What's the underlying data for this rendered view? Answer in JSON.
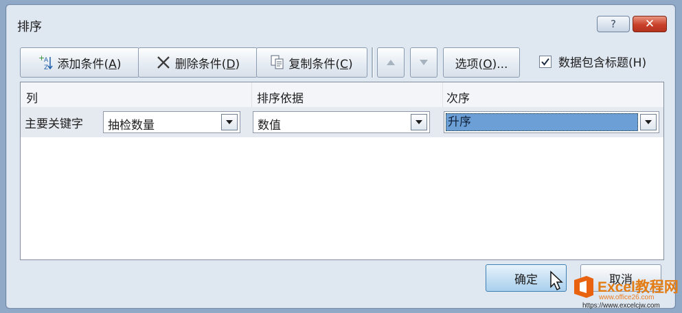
{
  "window": {
    "title": "排序",
    "help_label": "?",
    "close_label": "✕"
  },
  "toolbar": {
    "add_label": "添加条件(",
    "add_key": "A",
    "add_tail": ")",
    "delete_label": "删除条件(",
    "delete_key": "D",
    "delete_tail": ")",
    "copy_label": "复制条件(",
    "copy_key": "C",
    "copy_tail": ")",
    "move_up_icon": "triangle-up-icon",
    "move_down_icon": "triangle-down-icon",
    "options_label": "选项(",
    "options_key": "O",
    "options_tail": ")...",
    "header_checkbox_label": "数据包含标题(",
    "header_checkbox_key": "H",
    "header_checkbox_tail": ")",
    "header_checkbox_checked": true
  },
  "grid": {
    "columns": [
      "列",
      "排序依据",
      "次序"
    ],
    "rows": [
      {
        "label": "主要关键字",
        "column": "抽检数量",
        "sort_on": "数值",
        "order": "升序"
      }
    ]
  },
  "footer": {
    "ok_label": "确定",
    "cancel_label": "取消"
  },
  "watermark": {
    "brand": "Excel教程网",
    "site1": "www.office26.com",
    "site2": "https://www.excelcjw.com"
  },
  "colors": {
    "accent": "#6c9fd6",
    "close": "#c9412b",
    "watermark": "#e47c14"
  }
}
